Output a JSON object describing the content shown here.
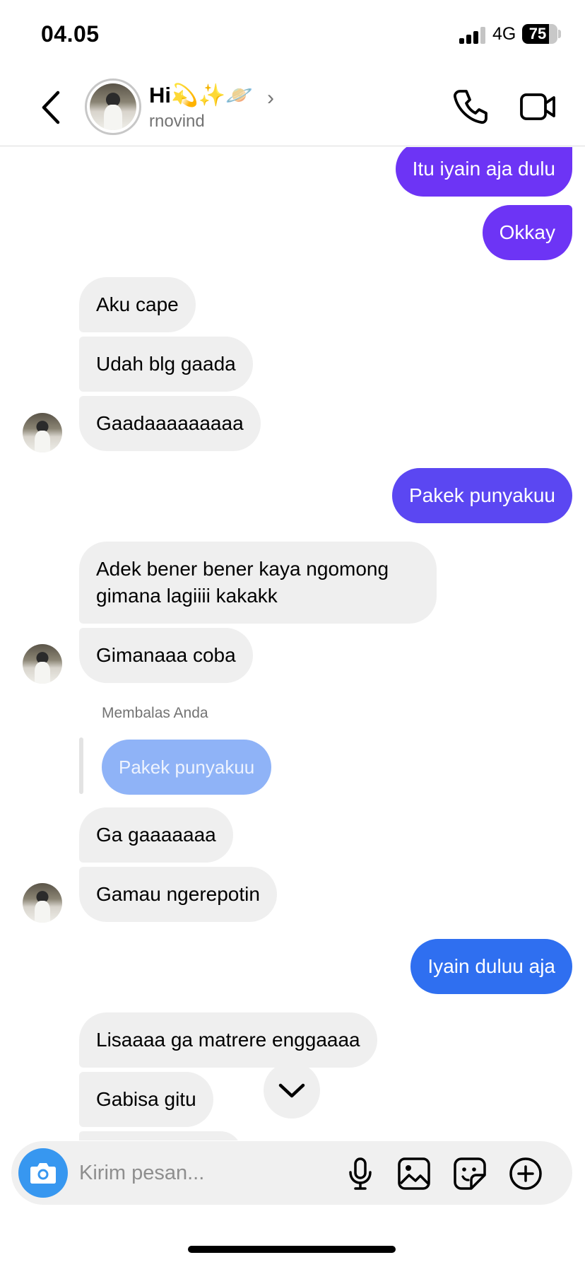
{
  "status_bar": {
    "time": "04.05",
    "network": "4G",
    "battery": "75",
    "battery_level": 0.75
  },
  "header": {
    "back_icon": "chevron-left-icon",
    "name": "Hi💫✨🪐",
    "chevron": "›",
    "username": "rnovind",
    "call_icon": "phone-icon",
    "video_icon": "video-camera-icon"
  },
  "colors": {
    "outgoing_purple": "#6d34f5",
    "outgoing_indigo": "#5b47f2",
    "outgoing_blue": "#2f6ff0",
    "incoming": "#efefef",
    "quoted_reply": "#8fb3f7"
  },
  "messages": [
    {
      "direction": "out",
      "text": "Itu iyain aja dulu"
    },
    {
      "direction": "out",
      "text": "Okkay"
    },
    {
      "direction": "in",
      "text": "Aku cape"
    },
    {
      "direction": "in",
      "text": "Udah blg gaada"
    },
    {
      "direction": "in",
      "text": "Gaadaaaaaaaaa"
    },
    {
      "direction": "out",
      "text": "Pakek punyakuu"
    },
    {
      "direction": "in",
      "text": "Adek bener bener kaya ngomong gimana lagiiii kakakk"
    },
    {
      "direction": "in",
      "text": "Gimanaaa coba"
    },
    {
      "direction": "in",
      "text": "Ga gaaaaaaa",
      "reply_label": "Membalas Anda",
      "reply_to": "Pakek punyakuu"
    },
    {
      "direction": "in",
      "text": "Gamau ngerepotin"
    },
    {
      "direction": "out",
      "text": "Iyain duluu aja"
    },
    {
      "direction": "in",
      "text": "Lisaaaa ga matrere enggaaaa"
    },
    {
      "direction": "in",
      "text": "Gabisa gitu"
    }
  ],
  "scroll_down_icon": "chevron-down-icon",
  "composer": {
    "camera_icon": "camera-icon",
    "placeholder": "Kirim pesan...",
    "value": "",
    "mic_icon": "microphone-icon",
    "gallery_icon": "image-icon",
    "sticker_icon": "sticker-icon",
    "more_icon": "plus-circle-icon"
  }
}
